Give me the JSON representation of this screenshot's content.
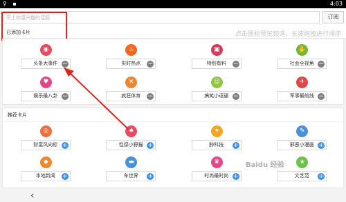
{
  "status": {
    "time": "4:03"
  },
  "search": {
    "placeholder": "写上你感兴趣的话题",
    "subscribe_label": "订阅"
  },
  "added": {
    "title": "已添加卡片",
    "hint": "点击图标预览频道，长按拖拽进行排序",
    "cards": [
      {
        "label": "头条大事件",
        "icon": "news-icon",
        "glyph": "◉",
        "color": "#e84a5f"
      },
      {
        "label": "实时热点",
        "icon": "flame-icon",
        "glyph": "♨",
        "color": "#f26522"
      },
      {
        "label": "特别有料",
        "icon": "bag-icon",
        "glyph": "▣",
        "color": "#e0365a"
      },
      {
        "label": "社会全视角",
        "icon": "handshake-icon",
        "glyph": "✋",
        "color": "#72b839"
      },
      {
        "label": "娱乐最八卦",
        "icon": "heart-icon",
        "glyph": "♥",
        "color": "#e8458b"
      },
      {
        "label": "疯狂体育",
        "icon": "sports-icon",
        "glyph": "✕",
        "color": "#f0862b"
      },
      {
        "label": "搞笑小逗逼",
        "icon": "smile-icon",
        "glyph": "☺",
        "color": "#8dc63f"
      },
      {
        "label": "军事最前线",
        "icon": "military-icon",
        "glyph": "✈",
        "color": "#e04848"
      }
    ]
  },
  "recommended": {
    "title": "推荐卡片",
    "cards": [
      {
        "label": "财富风向标",
        "icon": "wealth-icon",
        "glyph": "◎",
        "color": "#f26d3d"
      },
      {
        "label": "性感小野猫",
        "icon": "cat-icon",
        "glyph": "♠",
        "color": "#e84a5f"
      },
      {
        "label": "醉科技",
        "icon": "tech-icon",
        "glyph": "✦",
        "color": "#f5a623"
      },
      {
        "label": "邪恶小漫画",
        "icon": "comic-icon",
        "glyph": "✎",
        "color": "#4a90d9"
      },
      {
        "label": "本地新闻",
        "icon": "local-news-icon",
        "glyph": "◆",
        "color": "#f0862b"
      },
      {
        "label": "车世界",
        "icon": "car-icon",
        "glyph": "▬",
        "color": "#4a90d9"
      },
      {
        "label": "时尚最时尚",
        "icon": "heels-icon",
        "glyph": "♛",
        "color": "#e8458b"
      },
      {
        "label": "文艺范",
        "icon": "book-icon",
        "glyph": "★",
        "color": "#6cc24a"
      }
    ]
  },
  "watermark": "Baidu 经验"
}
